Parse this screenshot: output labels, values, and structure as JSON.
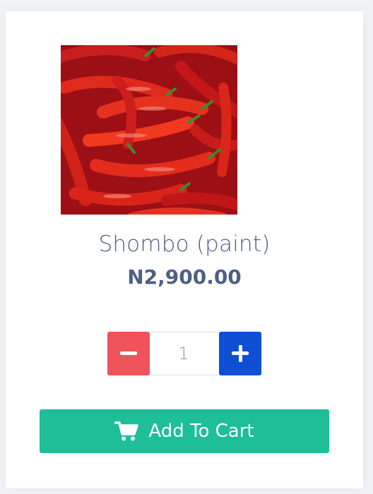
{
  "product": {
    "name": "Shombo (paint)",
    "price": "N2,900.00",
    "image_icon": "chili-pepper-image"
  },
  "quantity": {
    "value": "1",
    "decrease_icon": "minus-icon",
    "increase_icon": "plus-icon"
  },
  "cart_button": {
    "label": "Add To Cart",
    "icon": "shopping-cart-icon"
  },
  "colors": {
    "text": "#4d5f86",
    "minus": "#f0545a",
    "plus": "#0e4fd5",
    "cart": "#1ebe97"
  }
}
